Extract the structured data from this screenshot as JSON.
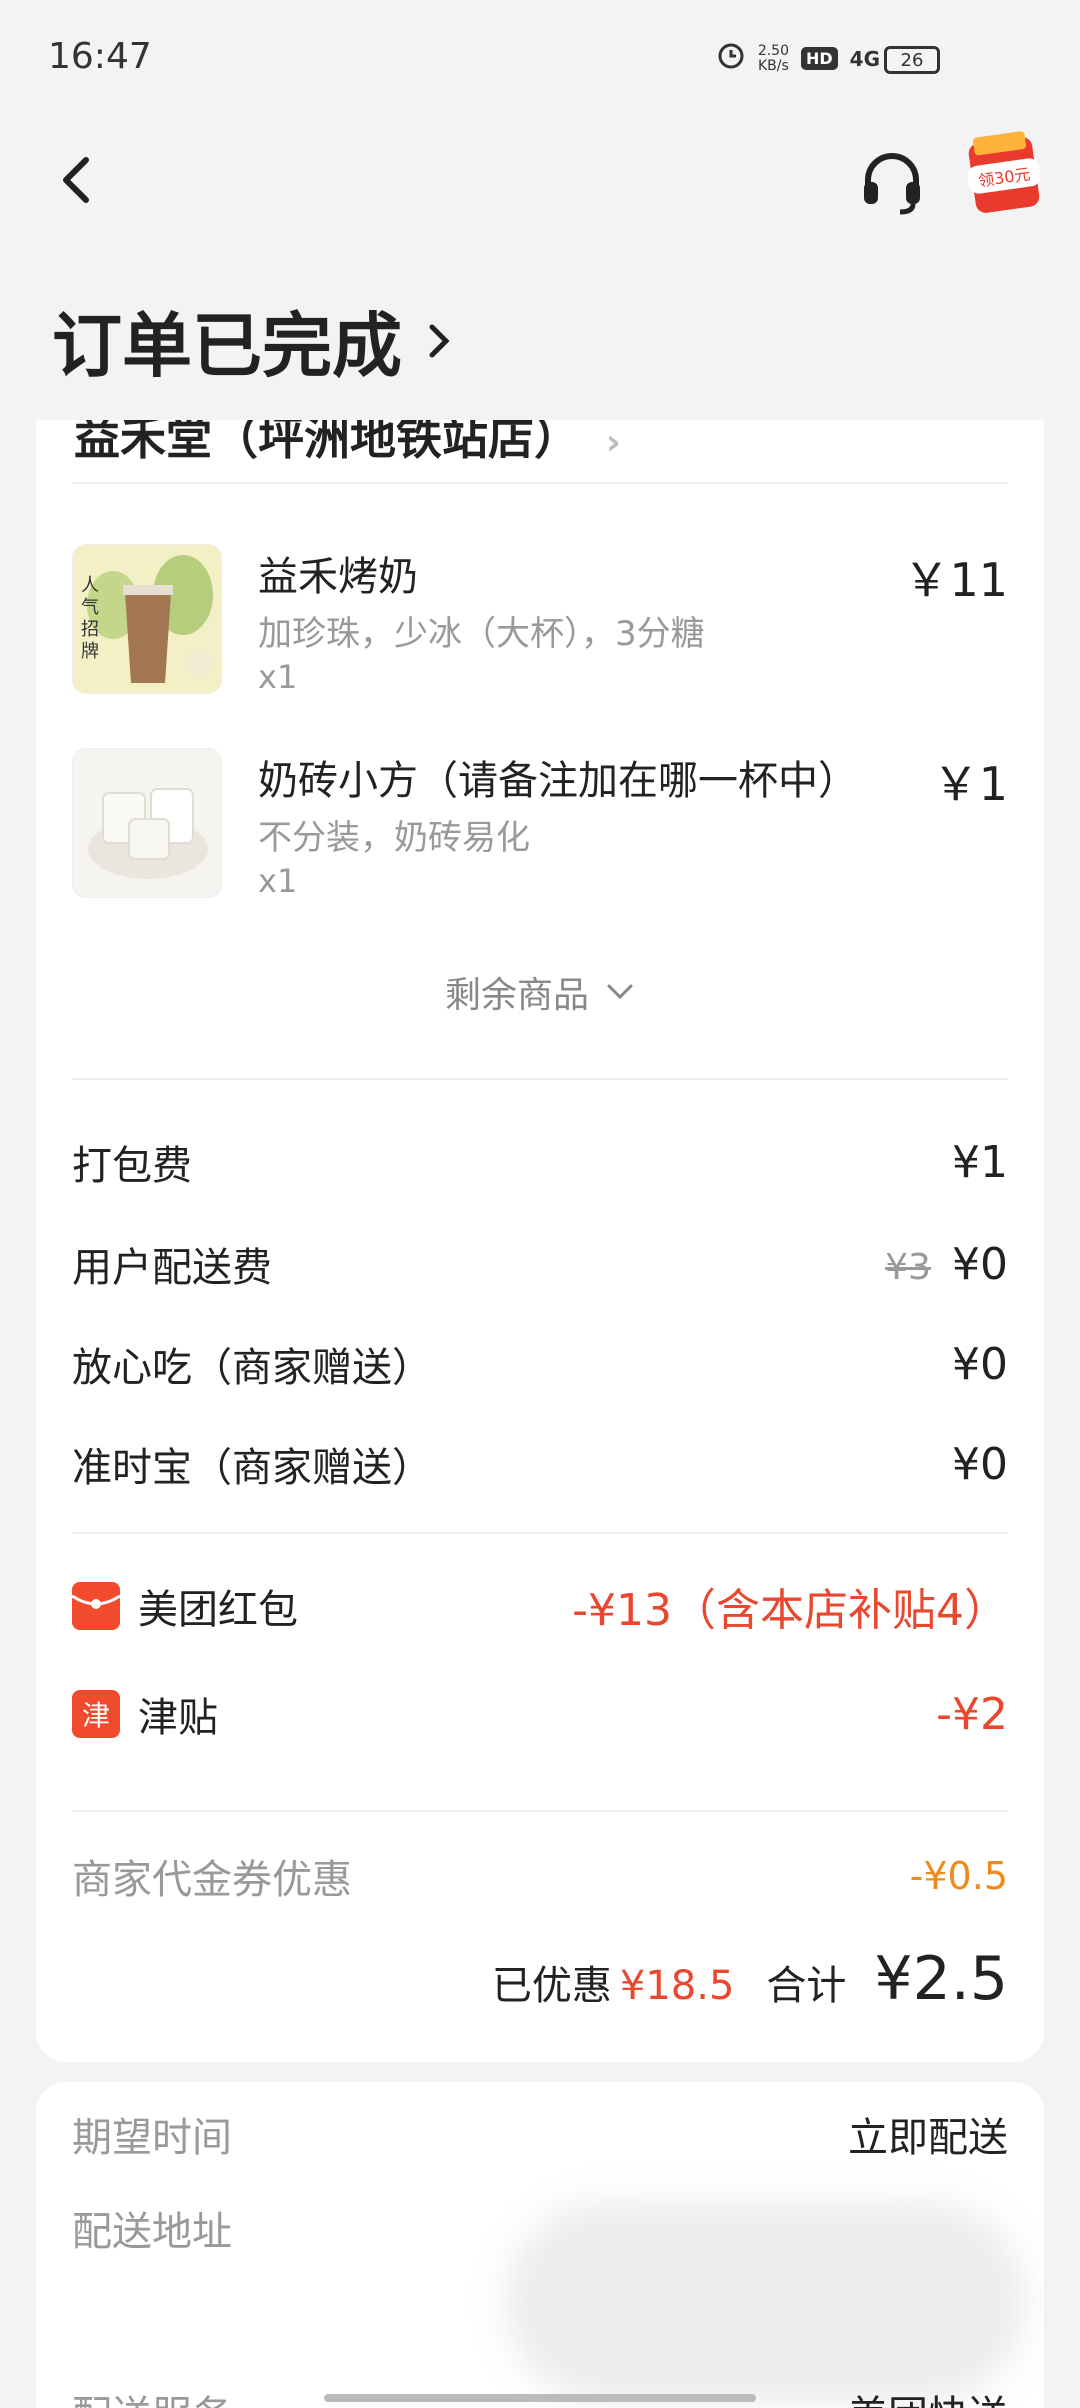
{
  "status_bar": {
    "time": "16:47",
    "net_speed_value": "2.50",
    "net_speed_unit": "KB/s",
    "hd": "HD",
    "network": "4G",
    "battery": "26",
    "alarm_icon": "alarm-clock-icon"
  },
  "nav": {
    "back_icon": "chevron-left-icon",
    "support_icon": "headset-icon",
    "promo_label": "领30元"
  },
  "page": {
    "title": "订单已完成"
  },
  "store": {
    "name": "益禾堂（坪洲地铁站店）"
  },
  "items": [
    {
      "name": "益禾烤奶",
      "spec": "加珍珠，少冰（大杯），3分糖",
      "qty": "x1",
      "price": "￥11",
      "thumb_text": "人气招牌"
    },
    {
      "name": "奶砖小方（请备注加在哪一杯中）",
      "spec": "不分装，奶砖易化",
      "qty": "x1",
      "price": "￥1",
      "thumb_text": ""
    }
  ],
  "expand": {
    "label": "剩余商品"
  },
  "fees": [
    {
      "label": "打包费",
      "original": "",
      "value": "¥1"
    },
    {
      "label": "用户配送费",
      "original": "¥3",
      "value": "¥0"
    },
    {
      "label": "放心吃（商家赠送）",
      "original": "",
      "value": "¥0"
    },
    {
      "label": "准时宝（商家赠送）",
      "original": "",
      "value": "¥0"
    }
  ],
  "promotions": [
    {
      "icon_text": "",
      "label": "美团红包",
      "value": "-¥13（含本店补贴4）"
    },
    {
      "icon_text": "津",
      "label": "津贴",
      "value": "-¥2"
    }
  ],
  "coupon": {
    "label": "商家代金券优惠",
    "value": "-¥0.5"
  },
  "summary": {
    "saved_label": "已优惠",
    "saved_value": "¥18.5",
    "total_label": "合计",
    "total_value": "¥2.5"
  },
  "delivery": {
    "expected_time_label": "期望时间",
    "expected_time_value": "立即配送",
    "address_label": "配送地址",
    "service_label": "配送服务",
    "service_value": "美团快送"
  },
  "colors": {
    "accent_red": "#e9472e",
    "coupon_orange": "#ef8a1c",
    "background": "#f3f3f3"
  }
}
